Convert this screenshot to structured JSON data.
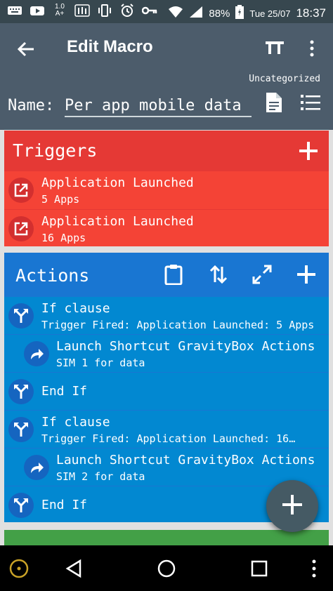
{
  "status_bar": {
    "speed": "1.0",
    "speed_sub": "A+",
    "battery": "88%",
    "date": "Tue 25/07",
    "time": "18:37",
    "icons": [
      "keyboard-icon",
      "youtube-icon",
      "speed-icon",
      "equalizer-icon",
      "vibrate-icon",
      "alarm-icon",
      "key-icon",
      "wifi-icon",
      "signal-icon",
      "battery-icon"
    ]
  },
  "app_bar": {
    "title": "Edit Macro",
    "category": "Uncategorized",
    "name_label": "Name:",
    "name_value": "Per app mobile data",
    "icons": [
      "back-arrow-icon",
      "text-size-icon",
      "more-vert-icon",
      "document-icon",
      "list-icon"
    ]
  },
  "triggers": {
    "title": "Triggers",
    "color": "#f44336",
    "items": [
      {
        "label": "Application Launched",
        "detail": "5 Apps",
        "icon": "open-in-new-icon"
      },
      {
        "label": "Application Launched",
        "detail": "16 Apps",
        "icon": "open-in-new-icon"
      }
    ]
  },
  "actions": {
    "title": "Actions",
    "color": "#0288d1",
    "header_icons": [
      "clipboard-icon",
      "reorder-icon",
      "expand-icon",
      "add-icon"
    ],
    "items": [
      {
        "label": "If clause",
        "detail": "Trigger Fired: Application Launched: 5 Apps",
        "icon": "fork-icon"
      },
      {
        "label": "Launch Shortcut GravityBox Actions",
        "detail": "SIM 1 for data",
        "icon": "share-arrow-icon"
      },
      {
        "label": "End If",
        "detail": "",
        "icon": "fork-icon"
      },
      {
        "label": "If clause",
        "detail": "Trigger Fired: Application Launched: 16…",
        "icon": "fork-icon"
      },
      {
        "label": "Launch Shortcut GravityBox Actions",
        "detail": "SIM 2 for data",
        "icon": "share-arrow-icon"
      },
      {
        "label": "End If",
        "detail": "",
        "icon": "fork-icon"
      }
    ]
  },
  "constraints": {
    "color": "#43a047"
  },
  "fab": {
    "icon": "add-icon"
  },
  "nav_bar": {
    "icons": [
      "assistant-icon",
      "back-triangle-icon",
      "home-circle-icon",
      "recents-square-icon",
      "more-vert-icon"
    ]
  }
}
